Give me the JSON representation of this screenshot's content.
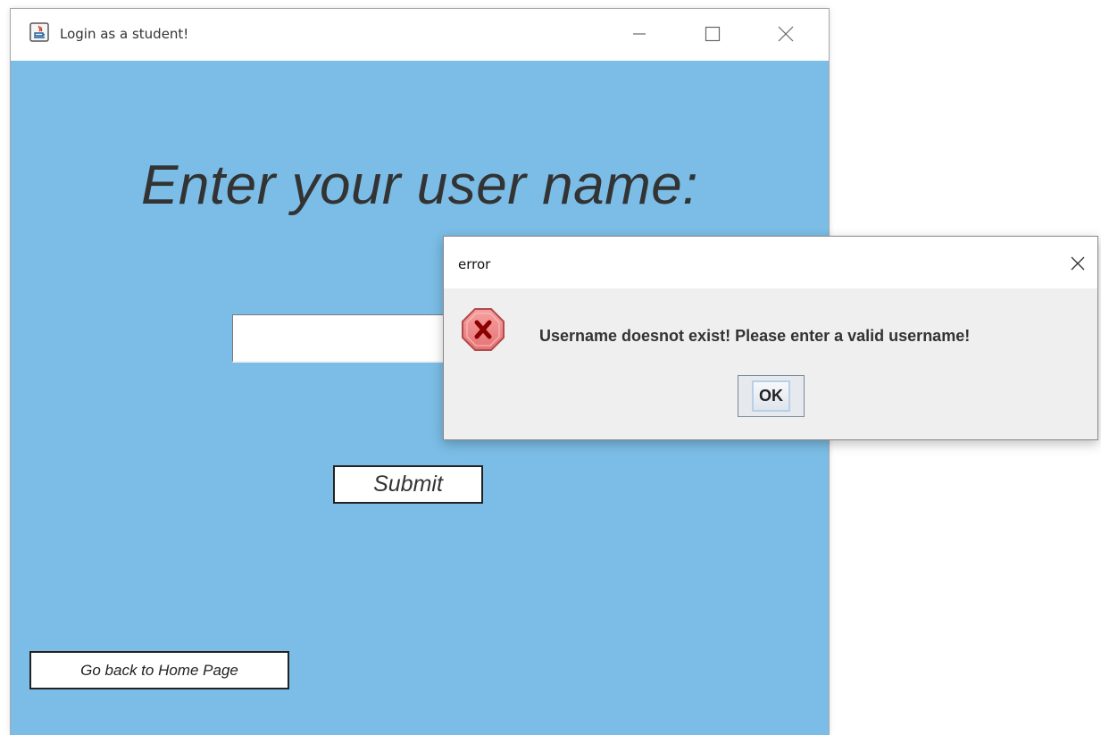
{
  "main_window": {
    "title": "Login as a student!",
    "heading": "Enter your user name:",
    "username_input": {
      "value": "",
      "placeholder": ""
    },
    "submit_label": "Submit",
    "home_label": "Go back to Home Page",
    "background_color": "#7bbde6"
  },
  "error_dialog": {
    "title": "error",
    "message": "Username doesnot exist! Please enter a valid username!",
    "ok_label": "OK",
    "icon": "error-icon"
  },
  "icons": {
    "app": "java-app-icon",
    "minimize": "minimize-icon",
    "maximize": "maximize-icon",
    "close": "close-icon"
  }
}
